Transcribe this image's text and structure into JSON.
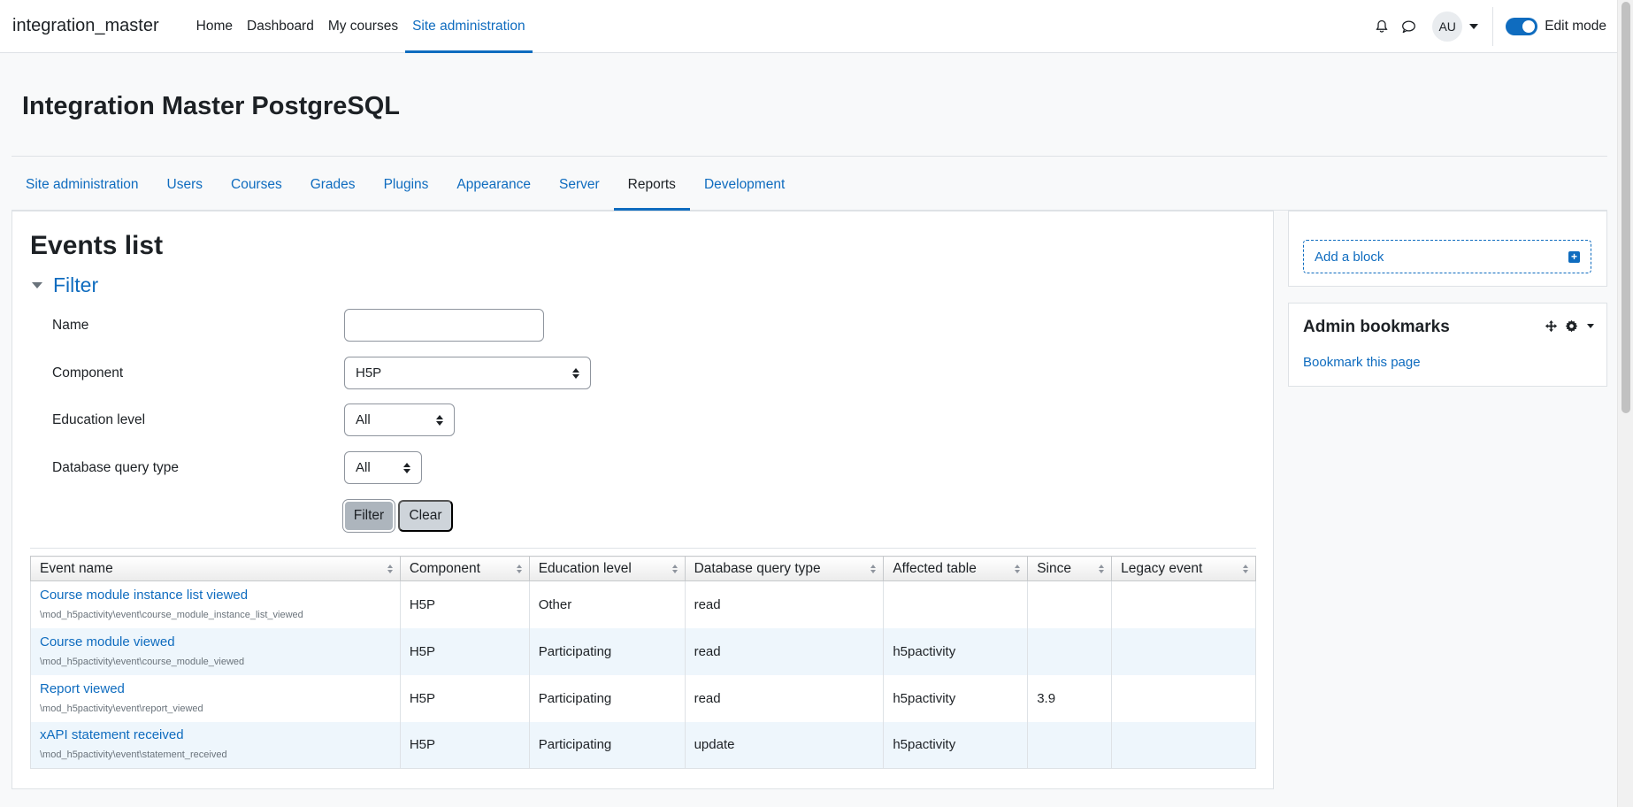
{
  "navbar": {
    "brand": "integration_master",
    "items": [
      {
        "label": "Home"
      },
      {
        "label": "Dashboard"
      },
      {
        "label": "My courses"
      },
      {
        "label": "Site administration"
      }
    ],
    "active_index": 3,
    "avatar_initials": "AU",
    "edit_mode_label": "Edit mode",
    "edit_mode_on": true
  },
  "page": {
    "title": "Integration Master PostgreSQL"
  },
  "secondary_nav": {
    "items": [
      {
        "label": "Site administration"
      },
      {
        "label": "Users"
      },
      {
        "label": "Courses"
      },
      {
        "label": "Grades"
      },
      {
        "label": "Plugins"
      },
      {
        "label": "Appearance"
      },
      {
        "label": "Server"
      },
      {
        "label": "Reports"
      },
      {
        "label": "Development"
      }
    ],
    "active_index": 7
  },
  "events": {
    "heading": "Events list",
    "filter": {
      "legend": "Filter",
      "name_label": "Name",
      "name_value": "",
      "component_label": "Component",
      "component_value": "H5P",
      "edulevel_label": "Education level",
      "edulevel_value": "All",
      "crud_label": "Database query type",
      "crud_value": "All",
      "filter_button": "Filter",
      "clear_button": "Clear"
    },
    "table": {
      "headers": [
        "Event name",
        "Component",
        "Education level",
        "Database query type",
        "Affected table",
        "Since",
        "Legacy event"
      ],
      "rows": [
        {
          "name": "Course module instance list viewed",
          "class": "\\mod_h5pactivity\\event\\course_module_instance_list_viewed",
          "component": "H5P",
          "edulevel": "Other",
          "crud": "read",
          "table": "",
          "since": "",
          "legacy": ""
        },
        {
          "name": "Course module viewed",
          "class": "\\mod_h5pactivity\\event\\course_module_viewed",
          "component": "H5P",
          "edulevel": "Participating",
          "crud": "read",
          "table": "h5pactivity",
          "since": "",
          "legacy": ""
        },
        {
          "name": "Report viewed",
          "class": "\\mod_h5pactivity\\event\\report_viewed",
          "component": "H5P",
          "edulevel": "Participating",
          "crud": "read",
          "table": "h5pactivity",
          "since": "3.9",
          "legacy": ""
        },
        {
          "name": "xAPI statement received",
          "class": "\\mod_h5pactivity\\event\\statement_received",
          "component": "H5P",
          "edulevel": "Participating",
          "crud": "update",
          "table": "h5pactivity",
          "since": "",
          "legacy": ""
        }
      ]
    }
  },
  "blocks": {
    "add_block_label": "Add a block",
    "admin_bookmarks": {
      "title": "Admin bookmarks",
      "link": "Bookmark this page"
    }
  },
  "colors": {
    "brand_blue": "#0f6cbf",
    "row_stripe": "#eef6fc",
    "border": "#dee2e6"
  },
  "icons": [
    "bell-icon",
    "chat-icon",
    "chevron-down-icon",
    "move-icon",
    "gear-icon",
    "plus-square-icon"
  ]
}
